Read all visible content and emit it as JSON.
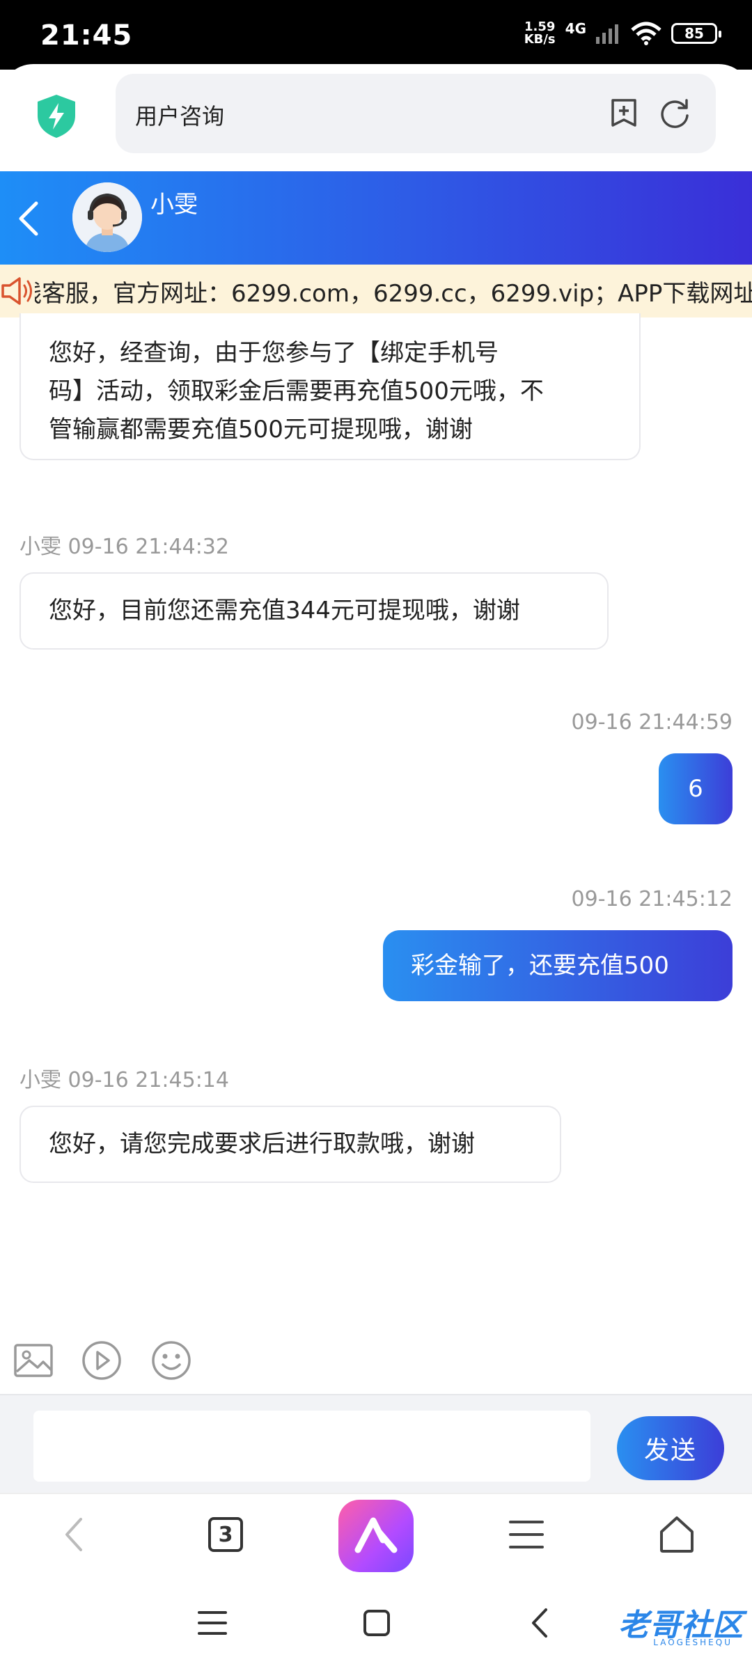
{
  "status_bar": {
    "time": "21:45",
    "net_speed_value": "1.59",
    "net_speed_unit": "KB/s",
    "network": "4G",
    "battery": "85"
  },
  "browser": {
    "address_text": "用户咨询",
    "shield_icon": "shield-bolt-icon",
    "bookmark_icon": "add-bookmark-icon",
    "refresh_icon": "refresh-icon"
  },
  "chat_header": {
    "agent_name": "小雯"
  },
  "notice": {
    "text": "线客服，官方网址：6299.com，6299.cc，6299.vip；APP下载网址"
  },
  "messages": [
    {
      "side": "in",
      "meta": "",
      "text_lines": [
        "您好，经查询，由于您参与了【绑定手机号",
        "码】活动，领取彩金后需要再充值500元哦，不",
        "管输赢都需要充值500元可提现哦，谢谢"
      ]
    },
    {
      "side": "in",
      "meta": "小雯 09-16 21:44:32",
      "text_lines": [
        "您好，目前您还需充值344元可提现哦，谢谢"
      ]
    },
    {
      "side": "out",
      "meta": "09-16 21:44:59",
      "text_lines": [
        "6"
      ]
    },
    {
      "side": "out",
      "meta": "09-16 21:45:12",
      "text_lines": [
        "彩金输了，还要充值500"
      ]
    },
    {
      "side": "in",
      "meta": "小雯 09-16 21:45:14",
      "text_lines": [
        "您好，请您完成要求后进行取款哦，谢谢"
      ]
    }
  ],
  "toolbar": {
    "image_icon": "image-icon",
    "video_icon": "play-circle-icon",
    "emoji_icon": "smiley-icon"
  },
  "composer": {
    "placeholder": "",
    "send_label": "发送"
  },
  "browser_nav": {
    "tab_count": "3"
  },
  "watermark": {
    "text": "老哥社区",
    "sub": "LAOGESHEQU"
  },
  "colors": {
    "accent_start": "#2a8ff0",
    "accent_end": "#3c3ed8",
    "notice_bg": "#fdf3da"
  }
}
